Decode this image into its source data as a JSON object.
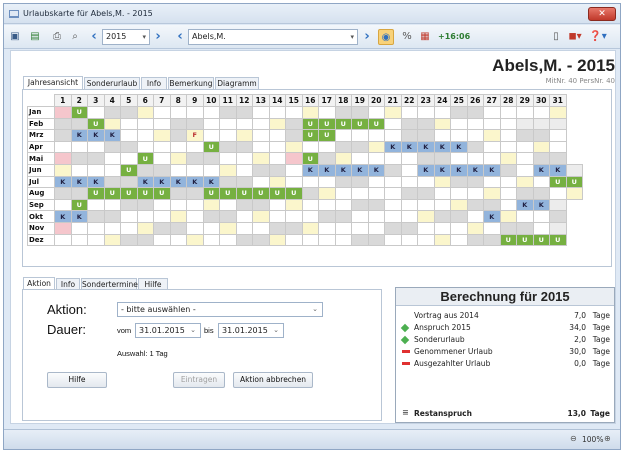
{
  "window": {
    "title": "Urlaubskarte für Abels,M. - 2015"
  },
  "toolbar": {
    "year": "2015",
    "employee": "Abels,M.",
    "time": "+16:06"
  },
  "header": {
    "employee_year": "Abels,M. - 2015",
    "ids": "MitNr. 40  PersNr. 40"
  },
  "tabs_top": [
    "Jahresansicht",
    "Sonderurlaub",
    "Info",
    "Bemerkung",
    "Diagramm"
  ],
  "calendar": {
    "days": [
      "1",
      "2",
      "3",
      "4",
      "5",
      "6",
      "7",
      "8",
      "9",
      "10",
      "11",
      "12",
      "13",
      "14",
      "15",
      "16",
      "17",
      "18",
      "19",
      "20",
      "21",
      "22",
      "23",
      "24",
      "25",
      "26",
      "27",
      "28",
      "29",
      "30",
      "31"
    ],
    "months": [
      {
        "name": "Jan",
        "cells": "PUeeeeeeeeeeeeeeeeeeeeeeeeeeeee"
      },
      {
        "name": "Feb",
        "cells": "eeUeeeeeeeeeeeeUUUUUeeeeeeeexxx"
      },
      {
        "name": "Mrz",
        "cells": "eKKKeeeeFeeeeeeUUeeeeeeeeeeeeee"
      },
      {
        "name": "Apr",
        "cells": "eeeeeeeeeUeeeeeeeeeeKKKKKeeeeee"
      },
      {
        "name": "Mai",
        "cells": "PeeeeUeeeeeeeePUeeeeeeeeeeeeeee"
      },
      {
        "name": "Jun",
        "cells": "eeeeUeeeeeeeeeeKKKKKeeKKKKKeeKKx"
      },
      {
        "name": "Jul",
        "cells": "KKKeeKKKKKeeeeeeeeeeeeeeeeeeeeUU"
      },
      {
        "name": "Aug",
        "cells": "eeUUUUUeeUUUUUUeeeeeeeeeeeeeeeee"
      },
      {
        "name": "Sep",
        "cells": "eUeeeeeeeeeeeeeeeeeeeeeeeeeeKKx"
      },
      {
        "name": "Okt",
        "cells": "KKeeeeeeeeeeeeeeeeeeeeeeeeKeeee"
      },
      {
        "name": "Nov",
        "cells": "Peeeeeeeeeeeeeeeeeeeeeeeeeeeeex"
      },
      {
        "name": "Dez",
        "cells": "eeeeeeeeeeeeeeeeeeeeeeeeeeeUUUU"
      }
    ]
  },
  "tabs_bottom": [
    "Aktion",
    "Info",
    "Sondertermine",
    "Hilfe"
  ],
  "action": {
    "label": "Aktion:",
    "select": "- bitte auswählen -",
    "dauer_label": "Dauer:",
    "from_label": "vom",
    "from": "31.01.2015",
    "to_label": "bis",
    "to": "31.01.2015",
    "selection": "Auswahl: 1 Tag",
    "help_btn": "Hilfe",
    "enter_btn": "Eintragen",
    "cancel_btn": "Aktion abbrechen"
  },
  "berechnung": {
    "title": "Berechnung für 2015",
    "rows": [
      {
        "label": "Vortrag aus 2014",
        "value": "7,0",
        "unit": "Tage",
        "marker": "none"
      },
      {
        "label": "Anspruch 2015",
        "value": "34,0",
        "unit": "Tage",
        "marker": "plus"
      },
      {
        "label": "Sonderurlaub",
        "value": "2,0",
        "unit": "Tage",
        "marker": "plus"
      },
      {
        "label": "Genommener Urlaub",
        "value": "30,0",
        "unit": "Tage",
        "marker": "minus"
      },
      {
        "label": "Ausgezahlter Urlaub",
        "value": "0,0",
        "unit": "Tage",
        "marker": "minus"
      }
    ],
    "total_label": "Restanspruch",
    "total_value": "13,0",
    "total_unit": "Tage"
  },
  "status": {
    "zoom": "100%"
  },
  "colors": {
    "vacation": "#76b041",
    "sick": "#92b4dc",
    "weekend": "#d9d9d9",
    "holiday": "#fbf6cc",
    "plus": "#4caf50",
    "minus": "#e03030"
  }
}
